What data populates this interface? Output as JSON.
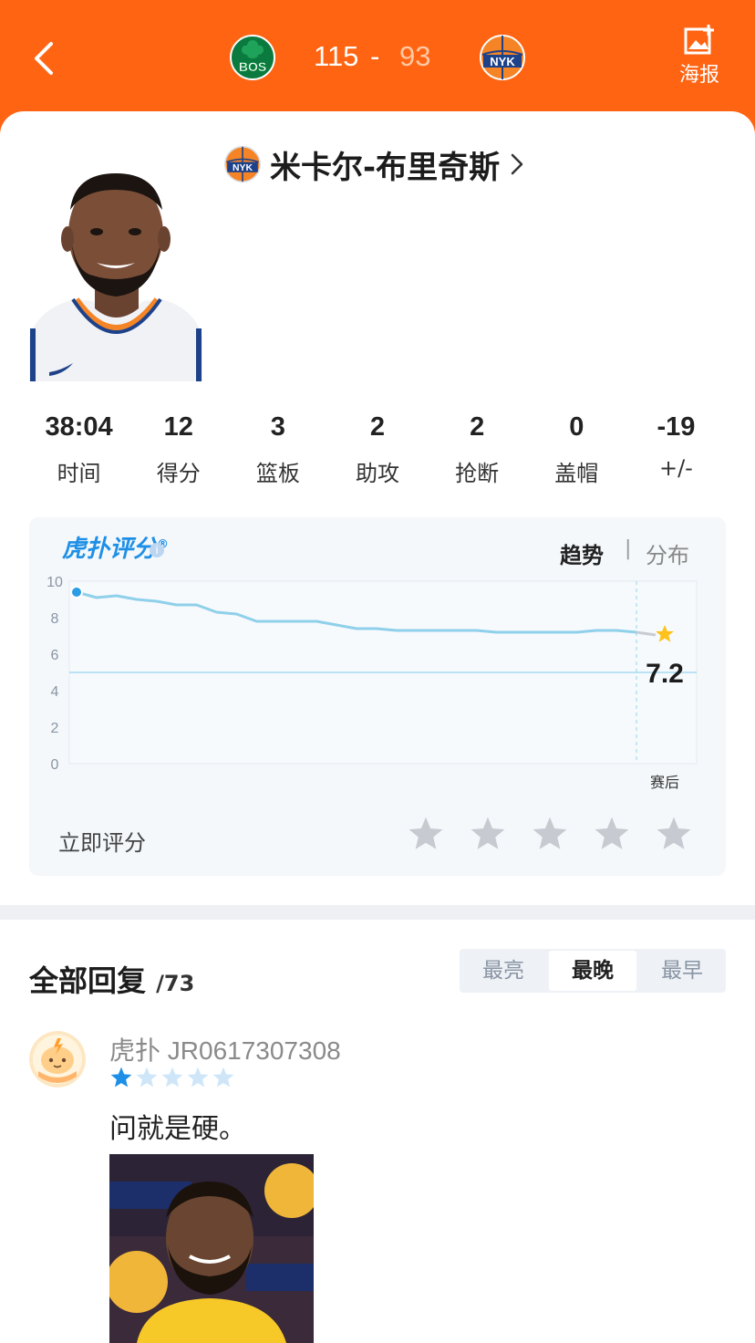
{
  "header": {
    "home_team": "BOS",
    "away_team": "NYK",
    "home_score": "115",
    "separator": "-",
    "away_score": "93",
    "poster_label": "海报"
  },
  "player": {
    "team": "NYK",
    "name": "米卡尔-布里奇斯"
  },
  "stats": [
    {
      "value": "38:04",
      "label": "时间"
    },
    {
      "value": "12",
      "label": "得分"
    },
    {
      "value": "3",
      "label": "篮板"
    },
    {
      "value": "2",
      "label": "助攻"
    },
    {
      "value": "2",
      "label": "抢断"
    },
    {
      "value": "0",
      "label": "盖帽"
    },
    {
      "value": "-19",
      "label": "+/-"
    }
  ],
  "rating": {
    "brand": "虎扑评分",
    "brand_mark": "®",
    "tab_trend": "趋势",
    "tab_sep": "|",
    "tab_dist": "分布",
    "rate_now": "立即评分"
  },
  "chart_data": {
    "type": "line",
    "y_ticks": [
      "10",
      "8",
      "6",
      "4",
      "2",
      "0"
    ],
    "ylim": [
      0,
      10
    ],
    "x_end_label": "赛后",
    "reference_line": 5,
    "final_value": "7.2",
    "series": [
      {
        "values": [
          9.4,
          9.1,
          9.2,
          9.0,
          8.9,
          8.7,
          8.7,
          8.3,
          8.2,
          7.8,
          7.8,
          7.8,
          7.8,
          7.6,
          7.4,
          7.4,
          7.3,
          7.3,
          7.3,
          7.3,
          7.3,
          7.2,
          7.2,
          7.2,
          7.2,
          7.2,
          7.3,
          7.3,
          7.2
        ]
      }
    ],
    "colors": {
      "line": "#8fd0ea",
      "point": "#2a9de6",
      "star": "#ffc21a"
    }
  },
  "comments": {
    "title": "全部回复",
    "count": "/73",
    "sort": [
      "最亮",
      "最晚",
      "最早"
    ],
    "active_sort": 1,
    "items": [
      {
        "user": "虎扑 JR0617307308",
        "stars": 1,
        "text": "问就是硬。"
      }
    ]
  }
}
